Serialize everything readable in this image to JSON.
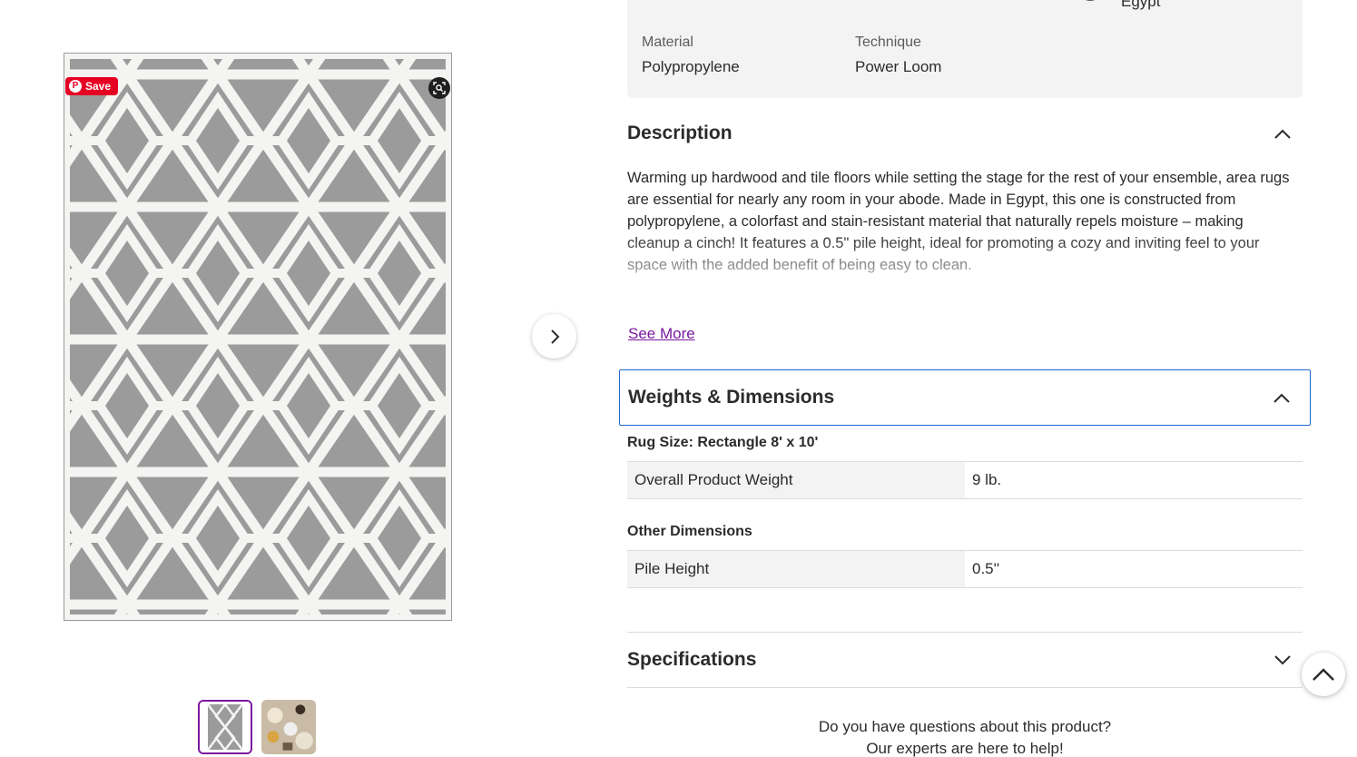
{
  "gallery": {
    "pin_save_label": "Save",
    "main_image_alt": "Gray and white geometric area rug",
    "thumbnails": [
      {
        "alt": "Rug pattern thumbnail",
        "active": true
      },
      {
        "alt": "Rug in room setting thumbnail",
        "active": false
      }
    ]
  },
  "specs": {
    "origin_value": "Egypt",
    "items": [
      {
        "label": "Material",
        "value": "Polypropylene"
      },
      {
        "label": "Technique",
        "value": "Power Loom"
      }
    ]
  },
  "description": {
    "heading": "Description",
    "text": "Warming up hardwood and tile floors while setting the stage for the rest of your ensemble, area rugs are essential for nearly any room in your abode. Made in Egypt, this one is constructed from polypropylene, a colorfast and stain-resistant material that naturally repels moisture – making cleanup a cinch! It features a 0.5\" pile height, ideal for promoting a cozy and inviting feel to your space with the added benefit of being easy to clean.",
    "see_more": "See More"
  },
  "weights_dimensions": {
    "heading": "Weights & Dimensions",
    "rug_size": "Rug Size: Rectangle 8' x 10'",
    "rows": [
      {
        "label": "Overall Product Weight",
        "value": "9 lb."
      }
    ],
    "other_heading": "Other Dimensions",
    "other_rows": [
      {
        "label": "Pile Height",
        "value": "0.5''"
      }
    ]
  },
  "specifications": {
    "heading": "Specifications"
  },
  "questions": {
    "line1": "Do you have questions about this product?",
    "line2": "Our experts are here to help!"
  },
  "colors": {
    "accent_purple": "#7b189f",
    "focus_blue": "#1e66d0",
    "pinterest_red": "#e60023",
    "rug_gray": "#9b9b9b"
  }
}
